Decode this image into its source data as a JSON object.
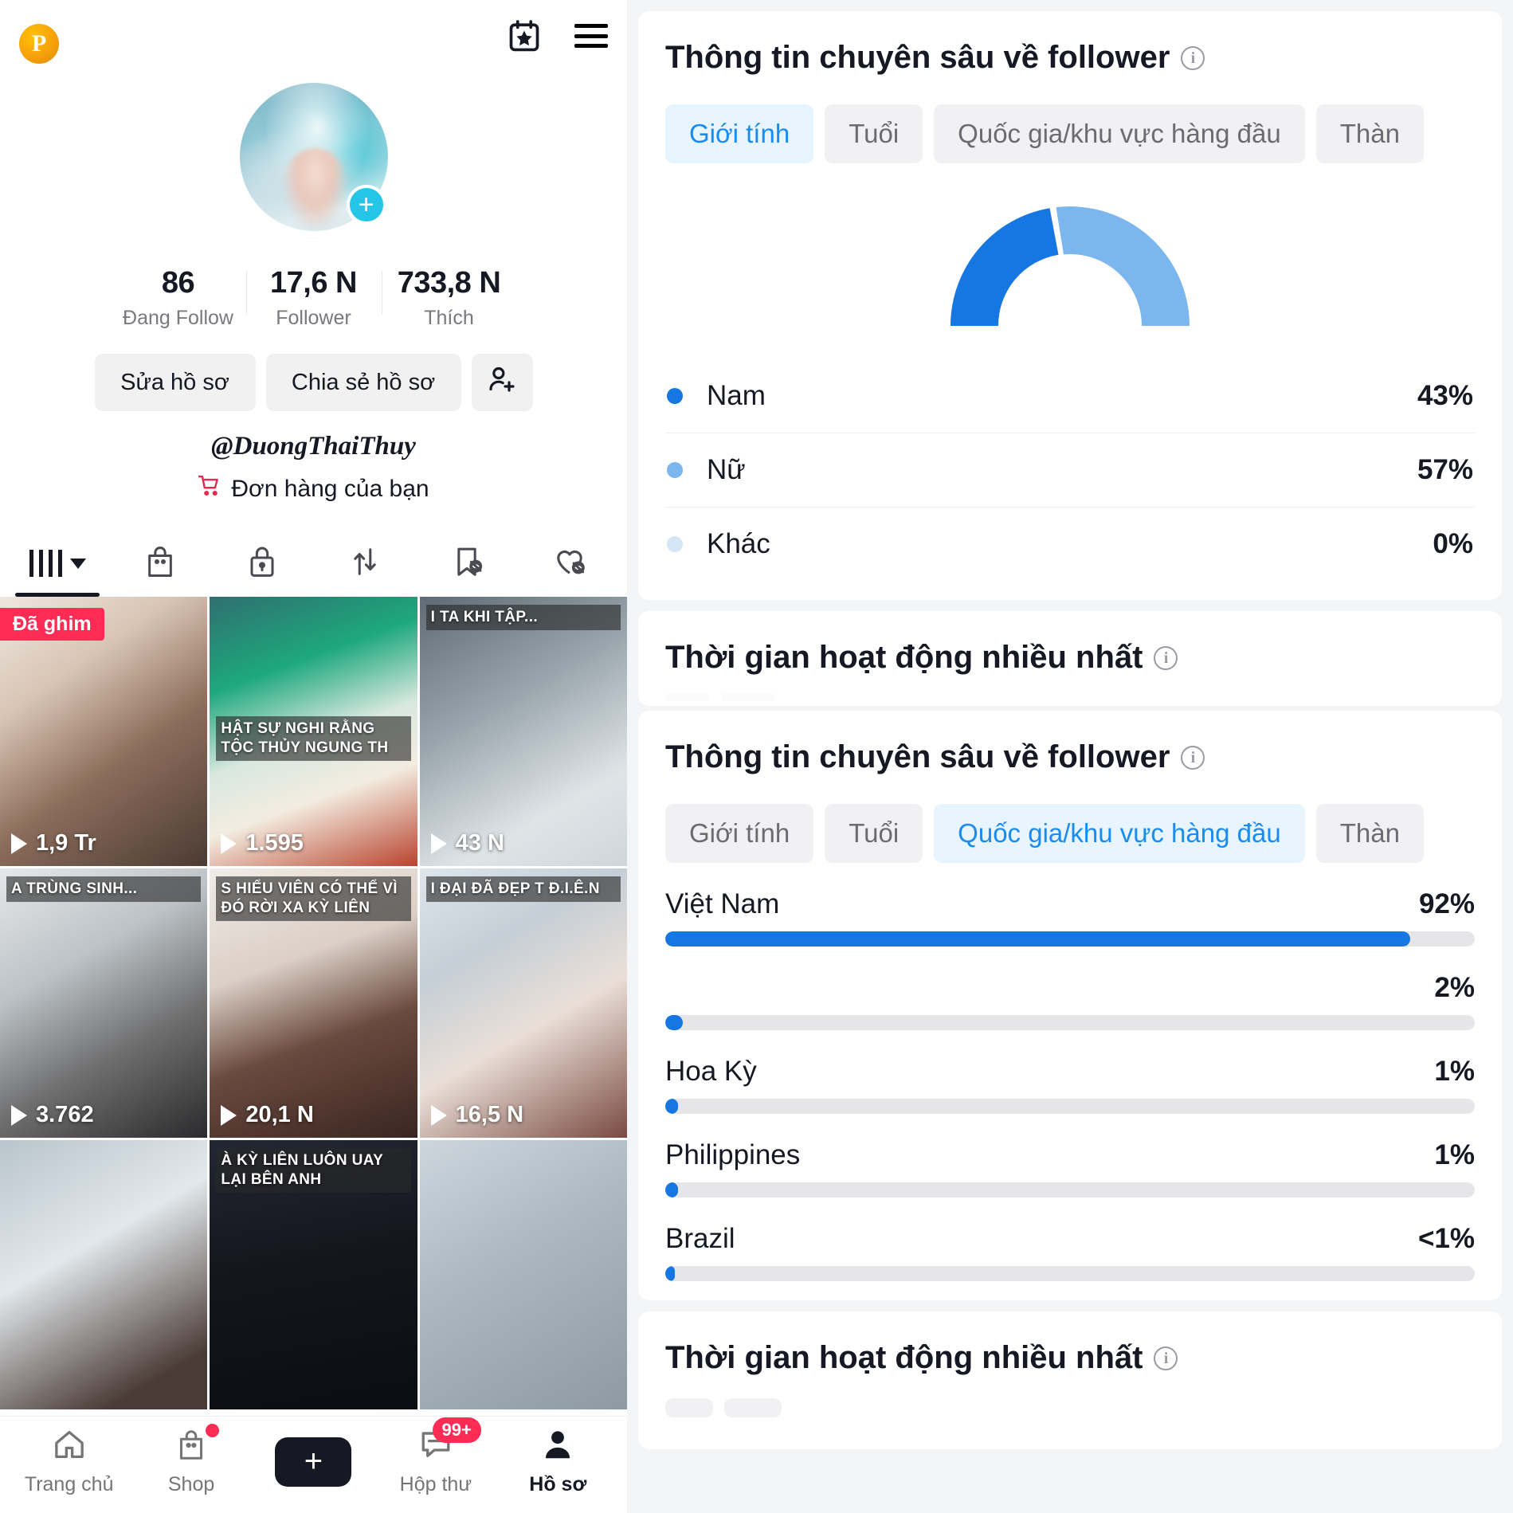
{
  "profile": {
    "logo_letter": "P",
    "header_icons": [
      "calendar-star-icon",
      "hamburger-menu-icon"
    ],
    "avatar_plus": "+",
    "stats": [
      {
        "value": "86",
        "label": "Đang Follow"
      },
      {
        "value": "17,6 N",
        "label": "Follower"
      },
      {
        "value": "733,8 N",
        "label": "Thích"
      }
    ],
    "actions": {
      "edit_label": "Sửa hồ sơ",
      "share_label": "Chia sẻ hồ sơ",
      "add_person_icon": "add-person-icon"
    },
    "handle": "@DuongThaiThuy",
    "orders_label": "Đơn hàng của bạn",
    "orders_icon": "shopping-cart-icon",
    "tabs": [
      {
        "icon": "grid-posts-icon",
        "active": true
      },
      {
        "icon": "shopping-bag-icon",
        "active": false
      },
      {
        "icon": "lock-private-icon",
        "active": false
      },
      {
        "icon": "repost-arrows-icon",
        "active": false
      },
      {
        "icon": "bookmark-hidden-icon",
        "active": false
      },
      {
        "icon": "heart-hidden-icon",
        "active": false
      }
    ],
    "videos": [
      {
        "caption": "",
        "plays": "1,9 Tr",
        "pinned_label": "Đã ghim",
        "thumb": "th1"
      },
      {
        "caption": "HẬT SỰ NGHI RẰNG TỘC THỦY NGUNG TH",
        "plays": "1.595",
        "pinned_label": "",
        "thumb": "th2"
      },
      {
        "caption": "I TA KHI TẬP...",
        "plays": "43 N",
        "pinned_label": "",
        "thumb": "th3"
      },
      {
        "caption": "A TRÙNG SINH...",
        "plays": "3.762",
        "pinned_label": "",
        "thumb": "th4"
      },
      {
        "caption": "S HIỂU VIÊN CÓ THỂ VÌ ĐÓ RỜI XA KỲ LIÊN",
        "plays": "20,1 N",
        "pinned_label": "",
        "thumb": "th5"
      },
      {
        "caption": "I ĐẠI ĐÃ ĐẸP T Đ.I.Ê.N",
        "plays": "16,5 N",
        "pinned_label": "",
        "thumb": "th6"
      },
      {
        "caption": "",
        "plays": "",
        "pinned_label": "",
        "thumb": "th7"
      },
      {
        "caption": "À KỲ LIÊN LUÔN UAY LẠI BÊN ANH",
        "plays": "",
        "pinned_label": "",
        "thumb": "th8"
      },
      {
        "caption": "",
        "plays": "",
        "pinned_label": "",
        "thumb": "th9"
      }
    ],
    "bottom_nav": [
      {
        "label": "Trang chủ",
        "icon": "home-icon",
        "badge": "",
        "active": false
      },
      {
        "label": "Shop",
        "icon": "shopping-bag-icon",
        "badge": "dot",
        "active": false
      },
      {
        "label": "",
        "icon": "create-plus-icon",
        "badge": "",
        "active": false
      },
      {
        "label": "Hộp thư",
        "icon": "message-icon",
        "badge": "99+",
        "active": false
      },
      {
        "label": "Hồ sơ",
        "icon": "person-icon",
        "badge": "",
        "active": true
      }
    ]
  },
  "insights": {
    "gender_card": {
      "title": "Thông tin chuyên sâu về follower",
      "info_icon": "info-icon",
      "chips": [
        "Giới tính",
        "Tuổi",
        "Quốc gia/khu vực hàng đầu",
        "Thàn"
      ],
      "active_chip": "Giới tính"
    },
    "activity_card_1": {
      "title": "Thời gian hoạt động nhiều nhất",
      "info_icon": "info-icon"
    },
    "country_card": {
      "title": "Thông tin chuyên sâu về follower",
      "info_icon": "info-icon",
      "chips": [
        "Giới tính",
        "Tuổi",
        "Quốc gia/khu vực hàng đầu",
        "Thàn"
      ],
      "active_chip": "Quốc gia/khu vực hàng đầu"
    },
    "activity_card_2": {
      "title": "Thời gian hoạt động nhiều nhất",
      "info_icon": "info-icon"
    }
  },
  "chart_data": [
    {
      "type": "pie",
      "title": "Giới tính",
      "subtitle": "Thông tin chuyên sâu về follower",
      "legend_position": "below",
      "labels": [
        "Nam",
        "Nữ",
        "Khác"
      ],
      "values": [
        43,
        57,
        0
      ],
      "display_values": [
        "43%",
        "57%",
        "0%"
      ],
      "colors": [
        "#1677e3",
        "#7bb6ef",
        "#d6e6f7"
      ],
      "shape": "half-donut"
    },
    {
      "type": "bar",
      "title": "Quốc gia/khu vực hàng đầu",
      "subtitle": "Thông tin chuyên sâu về follower",
      "orientation": "horizontal",
      "categories": [
        "Việt Nam",
        "",
        "Hoa Kỳ",
        "Philippines",
        "Brazil"
      ],
      "values": [
        92,
        2,
        1,
        1,
        0.5
      ],
      "display_values": [
        "92%",
        "2%",
        "1%",
        "1%",
        "<1%"
      ],
      "xlabel": "",
      "ylabel": "",
      "xlim": [
        0,
        100
      ],
      "grid": false,
      "bar_color": "#1677e3",
      "track_color": "#e6e6e9"
    }
  ]
}
